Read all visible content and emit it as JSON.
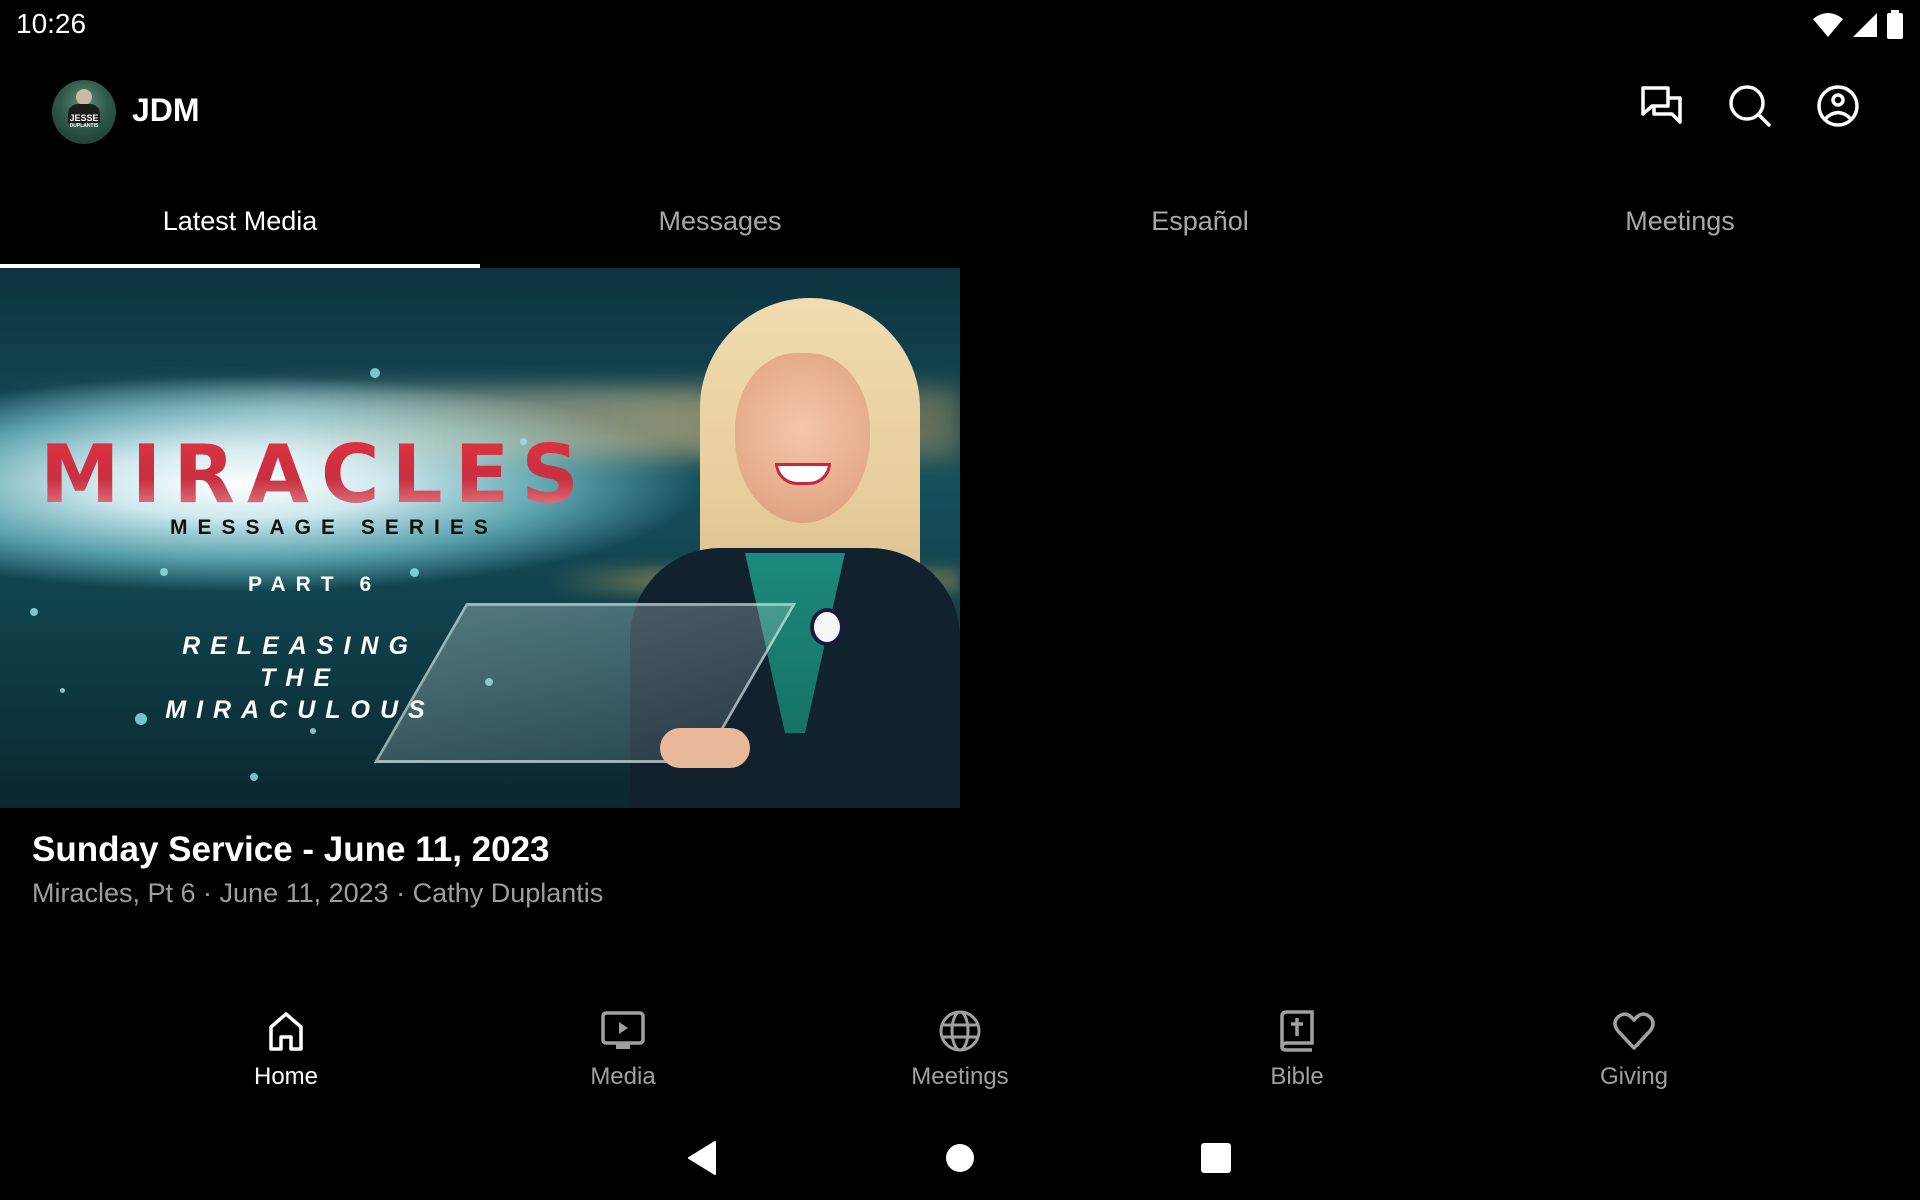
{
  "status_bar": {
    "time": "10:26",
    "icons": [
      "wifi-icon",
      "cellular-signal-icon",
      "battery-icon"
    ]
  },
  "header": {
    "app_title": "JDM",
    "avatar_text_line1": "JESSE",
    "avatar_text_line2": "DUPLANTIS",
    "actions": [
      {
        "name": "chat-icon",
        "label": "Messages"
      },
      {
        "name": "search-icon",
        "label": "Search"
      },
      {
        "name": "account-icon",
        "label": "Account"
      }
    ]
  },
  "tabs": [
    {
      "label": "Latest Media",
      "active": true
    },
    {
      "label": "Messages",
      "active": false
    },
    {
      "label": "Español",
      "active": false
    },
    {
      "label": "Meetings",
      "active": false
    }
  ],
  "media_card": {
    "thumbnail": {
      "series_title": "MIRACLES",
      "series_subtitle": "MESSAGE SERIES",
      "part": "PART 6",
      "episode_title": "RELEASING THE MIRACULOUS"
    },
    "title": "Sunday Service - June 11, 2023",
    "meta": "Miracles, Pt 6 · June 11, 2023 · Cathy Duplantis"
  },
  "bottom_nav": [
    {
      "label": "Home",
      "icon": "home-icon",
      "active": true
    },
    {
      "label": "Media",
      "icon": "media-tv-icon",
      "active": false
    },
    {
      "label": "Meetings",
      "icon": "globe-icon",
      "active": false
    },
    {
      "label": "Bible",
      "icon": "bible-icon",
      "active": false
    },
    {
      "label": "Giving",
      "icon": "heart-icon",
      "active": false
    }
  ],
  "colors": {
    "background": "#000000",
    "text_primary": "#ffffff",
    "text_secondary": "#9e9e9e",
    "tab_inactive": "#a8a8a8",
    "accent_red": "#d02a36"
  }
}
